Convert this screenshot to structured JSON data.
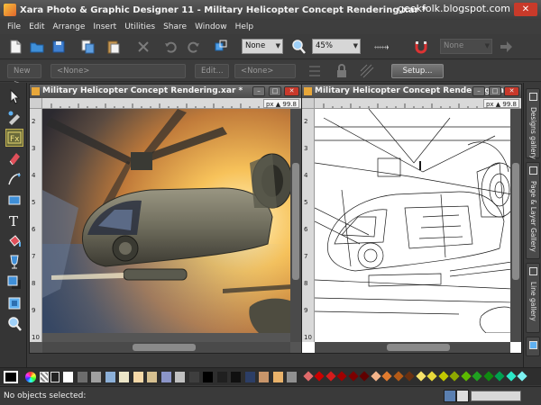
{
  "window": {
    "title": "Xara Photo & Graphic Designer 11 - Military Helicopter Concept Rendering.xar *",
    "watermark": "geekfolk.blogspot.com",
    "close_glyph": "✕"
  },
  "menu": [
    "File",
    "Edit",
    "Arrange",
    "Insert",
    "Utilities",
    "Share",
    "Window",
    "Help"
  ],
  "toolbar": {
    "quality_select": "None",
    "zoom_select": "45%",
    "right_select": "None"
  },
  "toolbar2": {
    "new_button": "New >",
    "none_select_1": "<None>",
    "edit_button": "Edit...",
    "none_select_2": "<None>",
    "setup_button": "Setup..."
  },
  "documents": [
    {
      "title": "Military Helicopter Concept Rendering.xar *",
      "ruler_readout": "px ▲ 99.8",
      "ruler_numbers": [
        "2",
        "3",
        "4",
        "5",
        "6",
        "7",
        "8",
        "9",
        "10"
      ]
    },
    {
      "title": "Military Helicopter Concept Rendering.xar *",
      "ruler_readout": "px ▲ 99.8",
      "ruler_numbers": [
        "2",
        "3",
        "4",
        "5",
        "6",
        "7",
        "8",
        "9",
        "10"
      ]
    }
  ],
  "window_buttons": {
    "minimize": "–",
    "maximize": "□",
    "close": "✕"
  },
  "galleries": [
    "Designs gallery",
    "Page & Layer Gallery",
    "Line gallery"
  ],
  "gallery_icons": [
    "designs-gallery-icon",
    "page-layer-gallery-icon",
    "line-gallery-icon",
    "fill-gallery-icon"
  ],
  "colors": {
    "swatches": [
      "#ffffff",
      "#6d6d6d",
      "#a0a0a0",
      "#8cb0d8",
      "#ece6c8",
      "#f6d9a8",
      "#d6c090",
      "#8b95c8",
      "#c0c0c0",
      "#3e3e3e",
      "#000000",
      "#202020",
      "#101010",
      "#2c3e66",
      "#c8956a",
      "#e9b26a",
      "#909090"
    ],
    "diamonds": [
      "#e06a6a",
      "#c80000",
      "#d41c1c",
      "#a00000",
      "#7c0000",
      "#600000",
      "#f4b48a",
      "#e07b2e",
      "#b45a16",
      "#6a3010",
      "#f6e26a",
      "#e7d83a",
      "#c2c800",
      "#8ea800",
      "#5cb800",
      "#20a020",
      "#108a10",
      "#00a050",
      "#2ce8c8",
      "#7cf2f2"
    ]
  },
  "status": {
    "text": "No objects selected:"
  }
}
